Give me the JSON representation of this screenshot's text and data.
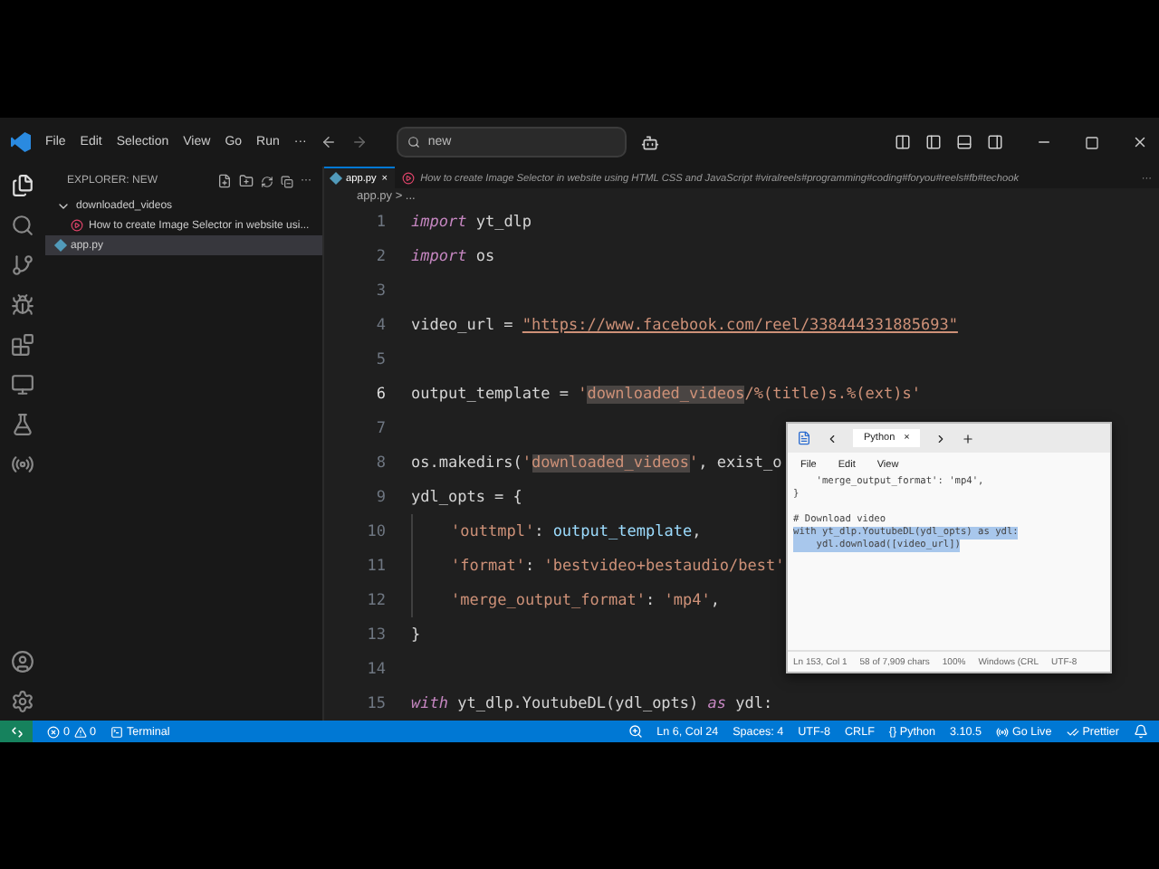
{
  "menu": [
    "File",
    "Edit",
    "Selection",
    "View",
    "Go",
    "Run",
    "···"
  ],
  "search": {
    "value": "new"
  },
  "explorer": {
    "title": "EXPLORER: NEW",
    "more": "···",
    "tree": [
      {
        "label": "downloaded_videos",
        "kind": "folder",
        "expanded": true,
        "selected": false,
        "children": [
          {
            "label": "How to create Image Selector in website usi...",
            "kind": "video",
            "selected": false
          }
        ]
      },
      {
        "label": "app.py",
        "kind": "python",
        "selected": true
      }
    ]
  },
  "tabs": [
    {
      "label": "app.py",
      "selected": true,
      "close": "×"
    },
    {
      "label": "How to create Image Selector in website using HTML CSS and JavaScript #viralreels#programming#coding#foryou#reels#fb#techook",
      "selected": false
    }
  ],
  "tabs_more": "···",
  "breadcrumb": "app.py > ...",
  "code": [
    {
      "n": "1",
      "current": false,
      "tokens": [
        {
          "t": "import",
          "kind": "keyword"
        },
        {
          "t": " yt_dlp",
          "kind": "plain"
        }
      ]
    },
    {
      "n": "2",
      "current": false,
      "tokens": [
        {
          "t": "import",
          "kind": "keyword"
        },
        {
          "t": " os",
          "kind": "plain"
        }
      ]
    },
    {
      "n": "3",
      "current": false
    },
    {
      "n": "4",
      "current": false,
      "tokens": [
        {
          "t": "video_url = ",
          "kind": "plain"
        },
        {
          "t": "\"https://www.facebook.com/reel/338444331885693\"",
          "kind": "url"
        }
      ]
    },
    {
      "n": "5",
      "current": false
    },
    {
      "n": "6",
      "current": true,
      "tokens": [
        {
          "t": "output_template = ",
          "kind": "plain"
        },
        {
          "t": "'",
          "kind": "string"
        },
        {
          "t": "downloaded_videos",
          "kind": "match"
        },
        {
          "t": "/%(title)s.%(ext)s'",
          "kind": "string"
        }
      ]
    },
    {
      "n": "7",
      "current": false
    },
    {
      "n": "8",
      "current": false,
      "tokens": [
        {
          "t": "os.makedirs(",
          "kind": "plain"
        },
        {
          "t": "'",
          "kind": "string"
        },
        {
          "t": "downloaded_videos",
          "kind": "match"
        },
        {
          "t": "'",
          "kind": "string"
        },
        {
          "t": ", exist_o",
          "kind": "plain"
        }
      ]
    },
    {
      "n": "9",
      "current": false,
      "tokens": [
        {
          "t": "ydl_opts = {",
          "kind": "plain"
        }
      ]
    },
    {
      "n": "10",
      "current": false,
      "indent": true,
      "tokens": [
        {
          "t": "'outtmpl'",
          "kind": "string"
        },
        {
          "t": ": ",
          "kind": "plain"
        },
        {
          "t": "output_template",
          "kind": "variable"
        },
        {
          "t": ",",
          "kind": "plain"
        }
      ]
    },
    {
      "n": "11",
      "current": false,
      "indent": true,
      "tokens": [
        {
          "t": "'format'",
          "kind": "string"
        },
        {
          "t": ": ",
          "kind": "plain"
        },
        {
          "t": "'bestvideo+bestaudio/best'",
          "kind": "string"
        }
      ]
    },
    {
      "n": "12",
      "current": false,
      "indent": true,
      "tokens": [
        {
          "t": "'merge_output_format'",
          "kind": "string"
        },
        {
          "t": ": ",
          "kind": "plain"
        },
        {
          "t": "'mp4'",
          "kind": "string"
        },
        {
          "t": ",",
          "kind": "plain"
        }
      ]
    },
    {
      "n": "13",
      "current": false,
      "tokens": [
        {
          "t": "}",
          "kind": "plain"
        }
      ]
    },
    {
      "n": "14",
      "current": false
    },
    {
      "n": "15",
      "current": false,
      "tokens": [
        {
          "t": "with",
          "kind": "keyword"
        },
        {
          "t": " yt_dlp.YoutubeDL(ydl_opts) ",
          "kind": "plain"
        },
        {
          "t": "as",
          "kind": "keyword"
        },
        {
          "t": " ydl:",
          "kind": "plain"
        }
      ]
    }
  ],
  "notepad": {
    "tab": "Python",
    "tab_close": "×",
    "menu": [
      "File",
      "Edit",
      "View"
    ],
    "lines": [
      {
        "text": "    'merge_output_format': 'mp4',",
        "selected": false
      },
      {
        "text": "}",
        "selected": false
      },
      {
        "selected": false
      },
      {
        "text": "# Download video",
        "selected": false
      },
      {
        "text": "with yt_dlp.YoutubeDL(ydl_opts) as ydl:",
        "selected": true
      },
      {
        "text": "    ydl.download([video_url])",
        "selected": true
      }
    ],
    "status": [
      "Ln 153, Col 1",
      "58 of 7,909 chars",
      "100%",
      "Windows (CRL",
      "UTF-8"
    ]
  },
  "status_bar": {
    "errors": "0",
    "warnings": "0",
    "terminal": "Terminal",
    "right": [
      {
        "text": "Ln 6, Col 24",
        "kind": "text"
      },
      {
        "text": "Spaces: 4",
        "kind": "text"
      },
      {
        "text": "UTF-8",
        "kind": "text"
      },
      {
        "text": "CRLF",
        "kind": "text"
      },
      {
        "text": "{} Python",
        "kind": "text"
      },
      {
        "text": "3.10.5",
        "kind": "text"
      },
      {
        "text": "Go Live",
        "kind": "live"
      },
      {
        "text": "Prettier",
        "kind": "prettier"
      }
    ]
  }
}
